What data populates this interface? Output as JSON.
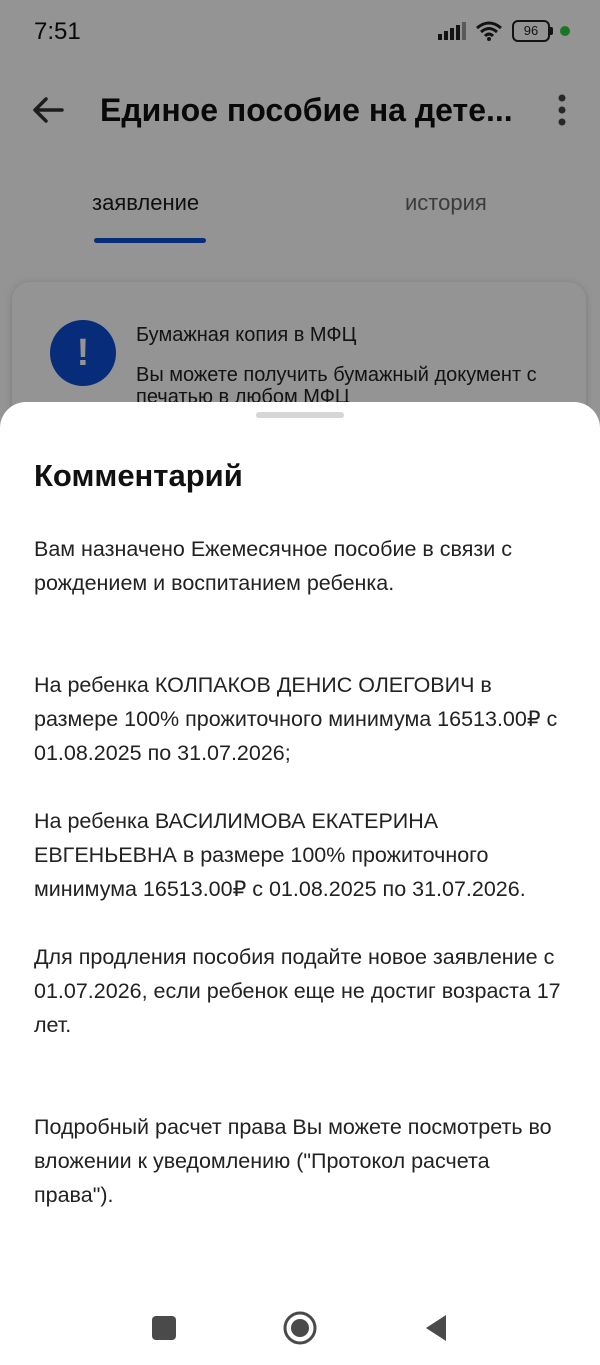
{
  "status_bar": {
    "time": "7:51",
    "battery": "96"
  },
  "app_bar": {
    "title": "Единое пособие на дете..."
  },
  "tabs": [
    {
      "label": "заявление",
      "active": true
    },
    {
      "label": "история",
      "active": false
    }
  ],
  "info_card": {
    "title": "Бумажная копия в МФЦ",
    "text": "Вы можете получить бумажный документ с печатью в любом МФЦ"
  },
  "sheet": {
    "title": "Комментарий",
    "paragraphs": [
      "Вам назначено Ежемесячное пособие в связи с рождением и воспитанием ребенка.",
      "На ребенка КОЛПАКОВ ДЕНИС ОЛЕГОВИЧ в размере 100% прожиточного минимума 16513.00₽ с 01.08.2025 по 31.07.2026;",
      "На ребенка ВАСИЛИМОВА ЕКАТЕРИНА ЕВГЕНЬЕВНА в размере 100% прожиточного минимума 16513.00₽ с 01.08.2025 по 31.07.2026.",
      "Для продления пособия подайте новое заявление с 01.07.2026, если ребенок еще не достиг возраста 17 лет.",
      "Подробный расчет права Вы можете посмотреть во вложении к уведомлению (\"Протокол расчета права\")."
    ]
  },
  "colors": {
    "accent": "#0d4cd3",
    "overlay": "rgba(0,0,0,0.42)"
  },
  "icons": {
    "back": "arrow-left-icon",
    "more": "more-vert-icon",
    "alert": "exclamation-icon",
    "nav_recents": "square-icon",
    "nav_home": "circle-icon",
    "nav_back": "triangle-back-icon"
  }
}
